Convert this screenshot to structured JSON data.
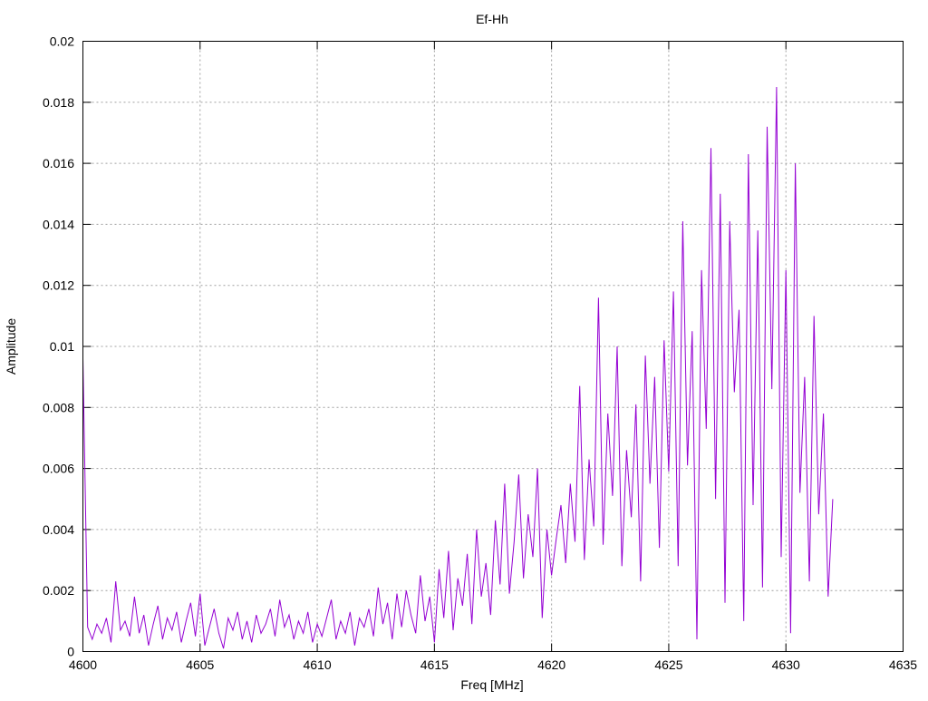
{
  "chart_data": {
    "type": "line",
    "title": "Ef-Hh",
    "xlabel": "Freq [MHz]",
    "ylabel": "Amplitude",
    "xlim": [
      4600,
      4635
    ],
    "ylim": [
      0,
      0.02
    ],
    "grid": true,
    "xticks": [
      "4600",
      "4605",
      "4610",
      "4615",
      "4620",
      "4625",
      "4630",
      "4635"
    ],
    "yticks": [
      "0",
      "0.002",
      "0.004",
      "0.006",
      "0.008",
      "0.01",
      "0.012",
      "0.014",
      "0.016",
      "0.018",
      "0.02"
    ],
    "series": [
      {
        "name": "Ef-Hh",
        "color": "#9400d3",
        "x_start": 4600,
        "x_step": 0.2,
        "values": [
          0.0096,
          0.0008,
          0.0004,
          0.0009,
          0.0006,
          0.0011,
          0.0003,
          0.0023,
          0.0007,
          0.001,
          0.0005,
          0.0018,
          0.0006,
          0.0012,
          0.0002,
          0.0009,
          0.0015,
          0.0004,
          0.0011,
          0.0007,
          0.0013,
          0.0003,
          0.001,
          0.0016,
          0.0005,
          0.0019,
          0.0002,
          0.0008,
          0.0014,
          0.0006,
          0.0001,
          0.0011,
          0.0007,
          0.0013,
          0.0004,
          0.001,
          0.0003,
          0.0012,
          0.0006,
          0.0009,
          0.0014,
          0.0005,
          0.0017,
          0.0008,
          0.0012,
          0.0004,
          0.001,
          0.0006,
          0.0013,
          0.0003,
          0.0009,
          0.0005,
          0.0011,
          0.0017,
          0.0004,
          0.001,
          0.0006,
          0.0013,
          0.0002,
          0.0011,
          0.0008,
          0.0014,
          0.0005,
          0.0021,
          0.0009,
          0.0016,
          0.0004,
          0.0019,
          0.0008,
          0.002,
          0.0012,
          0.0006,
          0.0025,
          0.001,
          0.0018,
          0.0003,
          0.0027,
          0.0011,
          0.0033,
          0.0007,
          0.0024,
          0.0015,
          0.0032,
          0.0009,
          0.004,
          0.0018,
          0.0029,
          0.0012,
          0.0043,
          0.0022,
          0.0055,
          0.0019,
          0.0036,
          0.0058,
          0.0024,
          0.0045,
          0.0031,
          0.006,
          0.0011,
          0.004,
          0.0025,
          0.0037,
          0.0048,
          0.0029,
          0.0055,
          0.0036,
          0.0087,
          0.003,
          0.0063,
          0.0041,
          0.0116,
          0.0035,
          0.0078,
          0.0051,
          0.01,
          0.0028,
          0.0066,
          0.0044,
          0.0081,
          0.0023,
          0.0097,
          0.0055,
          0.009,
          0.0034,
          0.0102,
          0.0059,
          0.0118,
          0.0028,
          0.0141,
          0.0061,
          0.0105,
          0.0004,
          0.0125,
          0.0073,
          0.0165,
          0.005,
          0.015,
          0.0016,
          0.0141,
          0.0085,
          0.0112,
          0.001,
          0.0163,
          0.0048,
          0.0138,
          0.0021,
          0.0172,
          0.0086,
          0.0185,
          0.0031,
          0.0125,
          0.0006,
          0.016,
          0.0052,
          0.009,
          0.0023,
          0.011,
          0.0045,
          0.0078,
          0.0018,
          0.005
        ]
      }
    ]
  }
}
